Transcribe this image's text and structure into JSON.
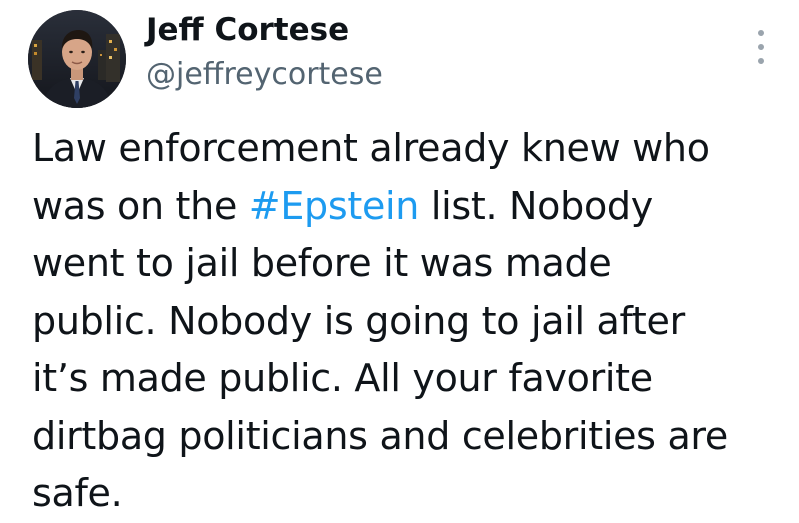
{
  "author": {
    "display_name": "Jeff Cortese",
    "handle": "@jeffreycortese",
    "avatar_icon": "profile-photo"
  },
  "menu": {
    "icon": "more-vertical-icon"
  },
  "tweet": {
    "lines": [
      {
        "before": "Law enforcement already knew who",
        "tag": "",
        "after": ""
      },
      {
        "before": "was on the ",
        "tag": "#Epstein",
        "after": " list. Nobody"
      },
      {
        "before": "went to jail before it was made",
        "tag": "",
        "after": ""
      },
      {
        "before": "public. Nobody is going to jail after",
        "tag": "",
        "after": ""
      },
      {
        "before": "it’s made public. All your favorite",
        "tag": "",
        "after": ""
      },
      {
        "before": "dirtbag politicians and celebrities are",
        "tag": "",
        "after": ""
      },
      {
        "before": "safe.",
        "tag": "",
        "after": ""
      }
    ]
  },
  "colors": {
    "text": "#0f1419",
    "secondary": "#536471",
    "hashtag": "#1d9bf0",
    "background": "#ffffff"
  }
}
